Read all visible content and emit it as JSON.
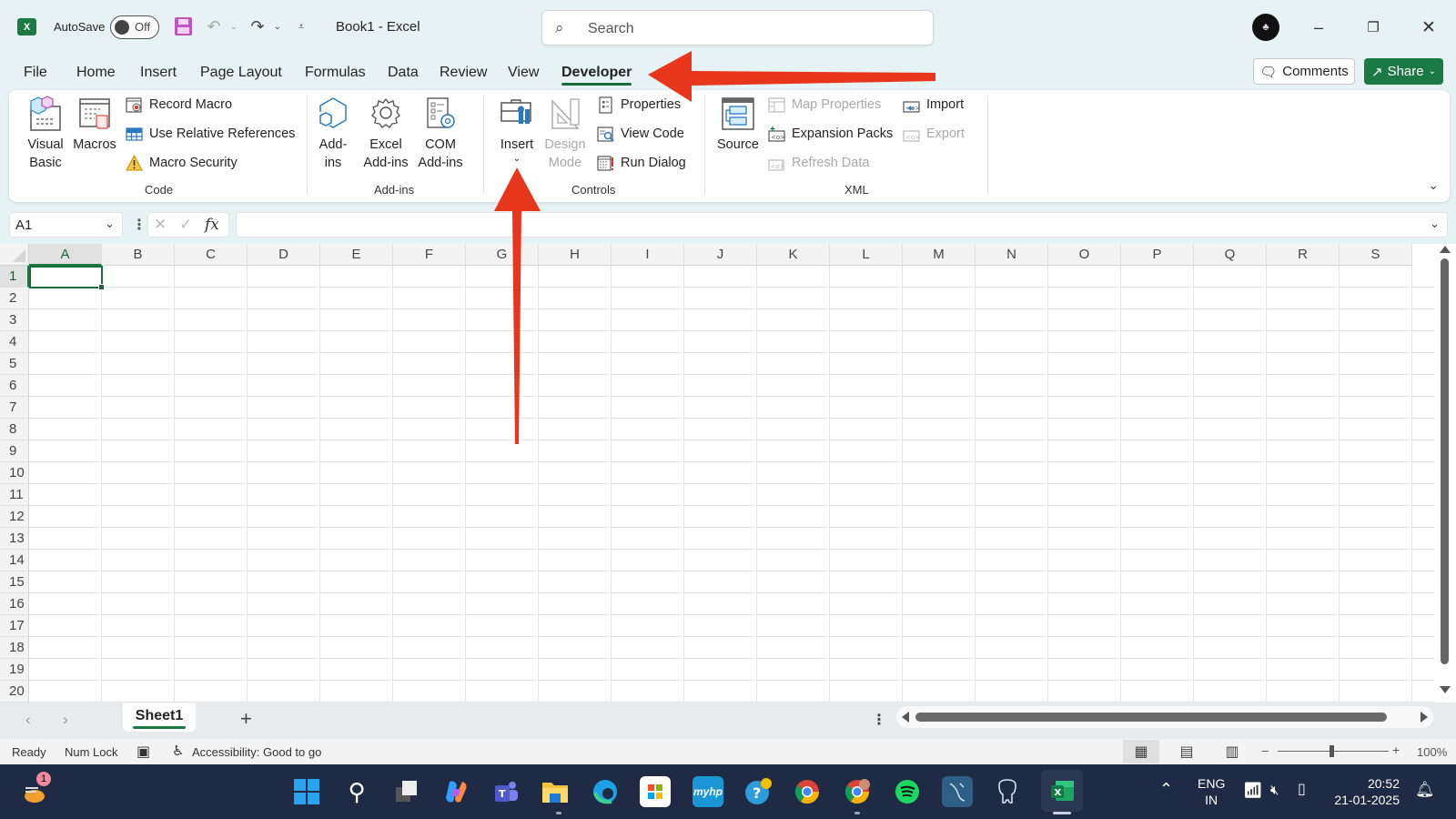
{
  "titlebar": {
    "autosave_label": "AutoSave",
    "autosave_state": "Off",
    "window_title": "Book1  -  Excel",
    "search_placeholder": "Search",
    "icons": [
      "excel-logo-icon",
      "save-icon",
      "undo-icon",
      "redo-icon",
      "customize-qat-icon",
      "search-icon",
      "account-avatar",
      "minimize-icon",
      "restore-icon",
      "close-icon"
    ]
  },
  "tabs": [
    {
      "label": "File"
    },
    {
      "label": "Home"
    },
    {
      "label": "Insert"
    },
    {
      "label": "Page Layout"
    },
    {
      "label": "Formulas"
    },
    {
      "label": "Data"
    },
    {
      "label": "Review"
    },
    {
      "label": "View"
    },
    {
      "label": "Developer",
      "active": true
    }
  ],
  "header_actions": {
    "comments_label": "Comments",
    "share_label": "Share"
  },
  "ribbon": {
    "code": {
      "label": "Code",
      "visual_basic": "Visual Basic",
      "visual_basic_l1": "Visual",
      "visual_basic_l2": "Basic",
      "macros": "Macros",
      "record_macro": "Record Macro",
      "use_relative_references": "Use Relative References",
      "macro_security": "Macro Security"
    },
    "addins": {
      "label": "Add-ins",
      "addins_l1": "Add-",
      "addins_l2": "ins",
      "excel_addins_l1": "Excel",
      "excel_addins_l2": "Add-ins",
      "com_addins_l1": "COM",
      "com_addins_l2": "Add-ins"
    },
    "controls": {
      "label": "Controls",
      "insert": "Insert",
      "design_mode_l1": "Design",
      "design_mode_l2": "Mode",
      "properties": "Properties",
      "view_code": "View Code",
      "run_dialog": "Run Dialog"
    },
    "xml": {
      "label": "XML",
      "source": "Source",
      "map_properties": "Map Properties",
      "expansion_packs": "Expansion Packs",
      "refresh_data": "Refresh Data",
      "import": "Import",
      "export": "Export"
    }
  },
  "formula_bar": {
    "name_box": "A1",
    "fx_label": "fx",
    "formula_value": ""
  },
  "grid": {
    "columns": [
      "A",
      "B",
      "C",
      "D",
      "E",
      "F",
      "G",
      "H",
      "I",
      "J",
      "K",
      "L",
      "M",
      "N",
      "O",
      "P",
      "Q",
      "R",
      "S"
    ],
    "rows": [
      "1",
      "2",
      "3",
      "4",
      "5",
      "6",
      "7",
      "8",
      "9",
      "10",
      "11",
      "12",
      "13",
      "14",
      "15",
      "16",
      "17",
      "18",
      "19",
      "20"
    ],
    "selected_cell": "A1"
  },
  "sheets": {
    "tabs": [
      {
        "label": "Sheet1",
        "active": true
      }
    ],
    "add_label": "+"
  },
  "statusbar": {
    "ready": "Ready",
    "num_lock": "Num Lock",
    "accessibility": "Accessibility: Good to go",
    "zoom": "100%",
    "zoom_minus": "−",
    "zoom_plus": "+"
  },
  "taskbar": {
    "notification_badge": "1",
    "apps": [
      "widgets",
      "start",
      "search",
      "task-view",
      "copilot",
      "teams",
      "file-explorer",
      "edge",
      "microsoft-store",
      "myhp",
      "get-help",
      "chrome",
      "chrome-profile",
      "spotify",
      "mysql-workbench",
      "postgresql",
      "excel"
    ],
    "myhp_label": "myhp",
    "language_l1": "ENG",
    "language_l2": "IN",
    "time": "20:52",
    "date": "21-01-2025"
  },
  "annotations": {
    "arrow_color": "#e8361c",
    "arrows": [
      {
        "points_to": "Developer tab"
      },
      {
        "points_to": "Insert controls button"
      }
    ]
  }
}
